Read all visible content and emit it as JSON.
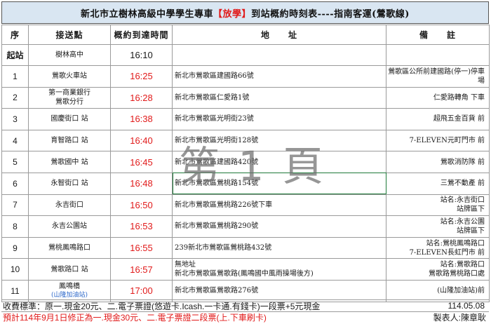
{
  "title": {
    "prefix": "新北市立樹林高級中學學生專車",
    "tag": "【放學】",
    "middle": "到站概約時刻表----",
    "operator": "指南客運(鶯歌線)"
  },
  "headers": {
    "no": "序",
    "stop": "接送點",
    "time": "概約到達時間",
    "address": "地　　址",
    "note": "備　　註"
  },
  "rows": [
    {
      "no": "起站",
      "stop": [
        "樹林高中"
      ],
      "time": "16:10",
      "address": [
        ""
      ],
      "note": [
        ""
      ]
    },
    {
      "no": "1",
      "stop": [
        "鶯歌火車站"
      ],
      "time": "16:25",
      "address": [
        "新北市鶯歌區建國路66號"
      ],
      "note": [
        "鶯歌區公所前建國路(停一)停車",
        "場"
      ]
    },
    {
      "no": "2",
      "stop": [
        "第一商業銀行",
        "鶯歌分行"
      ],
      "time": "16:28",
      "address": [
        "新北市鶯歌區仁愛路1號"
      ],
      "note": [
        "仁愛路轉角 下車"
      ]
    },
    {
      "no": "3",
      "stop": [
        "國慶街口 站"
      ],
      "time": "16:38",
      "address": [
        "新北市鶯歌區光明街23號"
      ],
      "note": [
        "超飛五金百貨 前"
      ]
    },
    {
      "no": "4",
      "stop": [
        "育智路口 站"
      ],
      "time": "16:40",
      "address": [
        "新北市鶯歌區光明街128號"
      ],
      "note": [
        "7-ELEVEN元町門市 前"
      ]
    },
    {
      "no": "5",
      "stop": [
        "鶯歌國中 站"
      ],
      "time": "16:45",
      "address": [
        "新北市鶯歌區建國路420號"
      ],
      "note": [
        "鶯歌消防隊 前"
      ]
    },
    {
      "no": "6",
      "stop": [
        "永智街口 站"
      ],
      "time": "16:48",
      "address": [
        "新北市鶯歌區鶯桃路154號"
      ],
      "note": [
        "三鶯不動產 前"
      ]
    },
    {
      "no": "7",
      "stop": [
        "永吉街口"
      ],
      "time": "16:50",
      "address": [
        "新北市鶯歌區鶯桃路226號下車"
      ],
      "note": [
        "站名:永吉街口",
        "站牌區下"
      ]
    },
    {
      "no": "8",
      "stop": [
        "永吉公園站"
      ],
      "time": "16:53",
      "address": [
        "新北市鶯歌區鶯桃路290號"
      ],
      "note": [
        "站名:永吉公園",
        "站牌區下"
      ]
    },
    {
      "no": "9",
      "stop": [
        "鶯桃鳳鳴路口"
      ],
      "time": "16:55",
      "address": [
        "239新北市鶯歌區鶯桃路432號"
      ],
      "note": [
        "站名:鶯桃鳳鳴路口",
        "7-ELEVEN長虹門市 前"
      ]
    },
    {
      "no": "10",
      "stop": [
        "鶯歌路口 站"
      ],
      "time": "16:57",
      "address": [
        "無地址",
        "新北市鶯歌區鶯歌路(鳳鳴國中風雨操場後方)"
      ],
      "note": [
        "站名:鶯歌路口",
        "鶯歌路鶯桃路口處"
      ]
    },
    {
      "no": "11",
      "stop": [
        "鳳鳴橋",
        "(山隆加油站)"
      ],
      "time": "17:00",
      "address": [
        "新北市鶯歌區鶯歌路276號"
      ],
      "note": [
        "(山隆加油站)前"
      ]
    }
  ],
  "watermark": "第 1 頁",
  "footer": {
    "fee": "收費標準：原一.現金20元、二.電子票證(悠遊卡.Icash.一卡通.有錢卡)一段票+5元現金",
    "date": "114.05.08",
    "notice": "預計114年9月1日修正為一.現金30元、二.電子票證二段票(上.下車刷卡)",
    "maker": "製表人:陳章耿"
  },
  "colors": {
    "red": "#e11a1a",
    "title_bg": "#d9e6f2",
    "sub_blue": "#2a66c9"
  }
}
